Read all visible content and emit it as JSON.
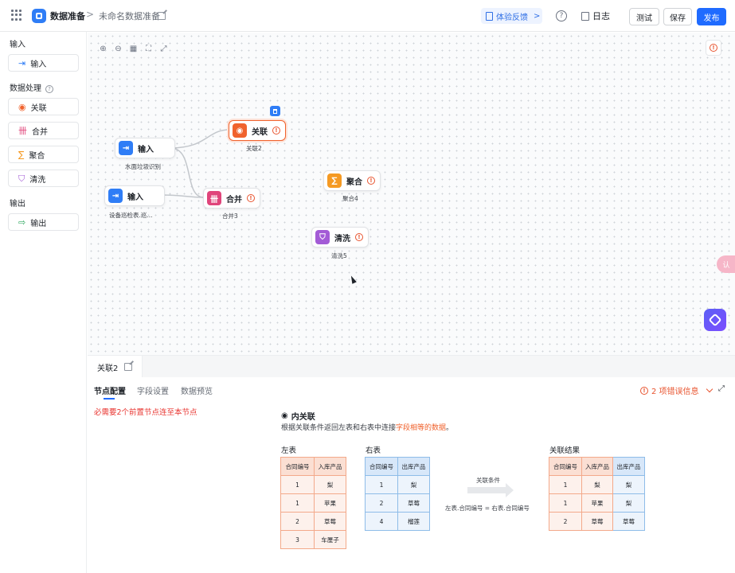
{
  "header": {
    "app_title": "数据准备",
    "breadcrumb_sep": ">",
    "doc_name": "未命名数据准备",
    "feedback_label": "体验反馈",
    "feedback_chevron": ">",
    "help_glyph": "?",
    "log_label": "日志",
    "test_label": "测试",
    "save_label": "保存",
    "publish_label": "发布"
  },
  "sidebar": {
    "input_section": "输入",
    "input_item": "输入",
    "process_section": "数据处理",
    "process_items": [
      "关联",
      "合并",
      "聚合",
      "清洗"
    ],
    "output_section": "输出",
    "output_item": "输出"
  },
  "canvas": {
    "nodes": [
      {
        "title": "输入",
        "label": "水面垃圾识别",
        "color": "#2f7df6"
      },
      {
        "title": "输入",
        "label": "设备巡检表.巡...",
        "color": "#2f7df6"
      },
      {
        "title": "关联",
        "label": "关联2",
        "color": "#f0622d"
      },
      {
        "title": "合并",
        "label": "合并3",
        "color": "#e0457b"
      },
      {
        "title": "聚合",
        "label": "聚合4",
        "color": "#f59a23"
      },
      {
        "title": "清洗",
        "label": "清洗5",
        "color": "#a35bd6"
      }
    ],
    "side_float_label": "认"
  },
  "panel": {
    "node_tab": "关联2",
    "subtabs": [
      "节点配置",
      "字段设置",
      "数据预览"
    ],
    "error_info": "2 项错误信息",
    "requirement": "必需要2个前置节点连至本节点",
    "join_title": "内关联",
    "join_desc_prefix": "根据关联条件返回左表和右表中连接",
    "join_desc_highlight": "字段相等的数据",
    "join_desc_suffix": "。",
    "left_table": {
      "caption": "左表",
      "headers": [
        "合同编号",
        "入库产品"
      ],
      "rows": [
        [
          "1",
          "梨"
        ],
        [
          "1",
          "苹果"
        ],
        [
          "2",
          "草莓"
        ],
        [
          "3",
          "车厘子"
        ]
      ]
    },
    "right_table": {
      "caption": "右表",
      "headers": [
        "合同编号",
        "出库产品"
      ],
      "rows": [
        [
          "1",
          "梨"
        ],
        [
          "2",
          "草莓"
        ],
        [
          "4",
          "榴莲"
        ]
      ]
    },
    "condition_label": "关联条件",
    "condition_expr": "左表.合同编号 = 右表.合同编号",
    "result_table": {
      "caption": "关联结果",
      "headers": [
        "合同编号",
        "入库产品",
        "出库产品"
      ],
      "rows": [
        [
          "1",
          "梨",
          "梨"
        ],
        [
          "1",
          "苹果",
          "梨"
        ],
        [
          "2",
          "草莓",
          "草莓"
        ]
      ]
    }
  },
  "colors": {
    "primary": "#1f6bff",
    "error": "#e8542f",
    "left_table": "#f3a98a",
    "right_table": "#8ebce8"
  }
}
